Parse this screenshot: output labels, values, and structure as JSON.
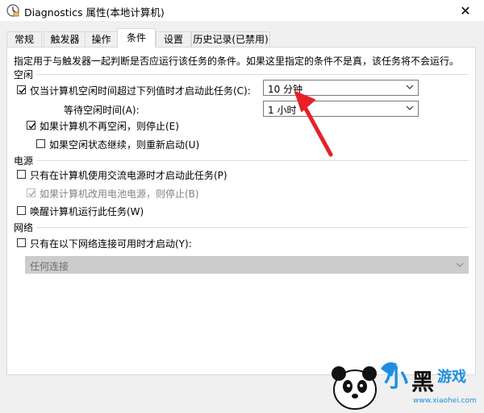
{
  "window": {
    "title": "Diagnostics 属性(本地计算机)",
    "close_glyph": "✕"
  },
  "tabs": [
    "常规",
    "触发器",
    "操作",
    "条件",
    "设置",
    "历史记录(已禁用)"
  ],
  "active_tab": "条件",
  "description": "指定用于与触发器一起判断是否应运行该任务的条件。如果这里指定的条件不是真，该任务将不会运行。",
  "idle": {
    "header": "空闲",
    "start_only_if_idle": {
      "label": "仅当计算机空闲时间超过下列值时才启动此任务(C):",
      "checked": true
    },
    "idle_duration": {
      "value": "10 分钟"
    },
    "wait_label": "等待空闲时间(A):",
    "wait_duration": {
      "value": "1 小时"
    },
    "stop_if_not_idle": {
      "label": "如果计算机不再空闲，则停止(E)",
      "checked": true
    },
    "restart_if_idle_resumes": {
      "label": "如果空闲状态继续，则重新启动(U)",
      "checked": false
    }
  },
  "power": {
    "header": "电源",
    "ac_power_only": {
      "label": "只有在计算机使用交流电源时才启动此任务(P)",
      "checked": false
    },
    "stop_on_battery": {
      "label": "如果计算机改用电池电源，则停止(B)",
      "checked": true,
      "disabled": true
    },
    "wake_to_run": {
      "label": "唤醒计算机运行此任务(W)",
      "checked": false
    }
  },
  "network": {
    "header": "网络",
    "only_if_network": {
      "label": "只有在以下网络连接可用时才启动(Y):",
      "checked": false
    },
    "connection": {
      "value": "任何连接",
      "disabled": true
    }
  },
  "watermark": {
    "brand": "小黑游戏",
    "url": "www.xiaohei.com"
  },
  "colors": {
    "arrow": "#e8202a",
    "accent_check": "#000000",
    "disabled_field": "#cccccc",
    "logo_blue": "#1e8fe0"
  }
}
